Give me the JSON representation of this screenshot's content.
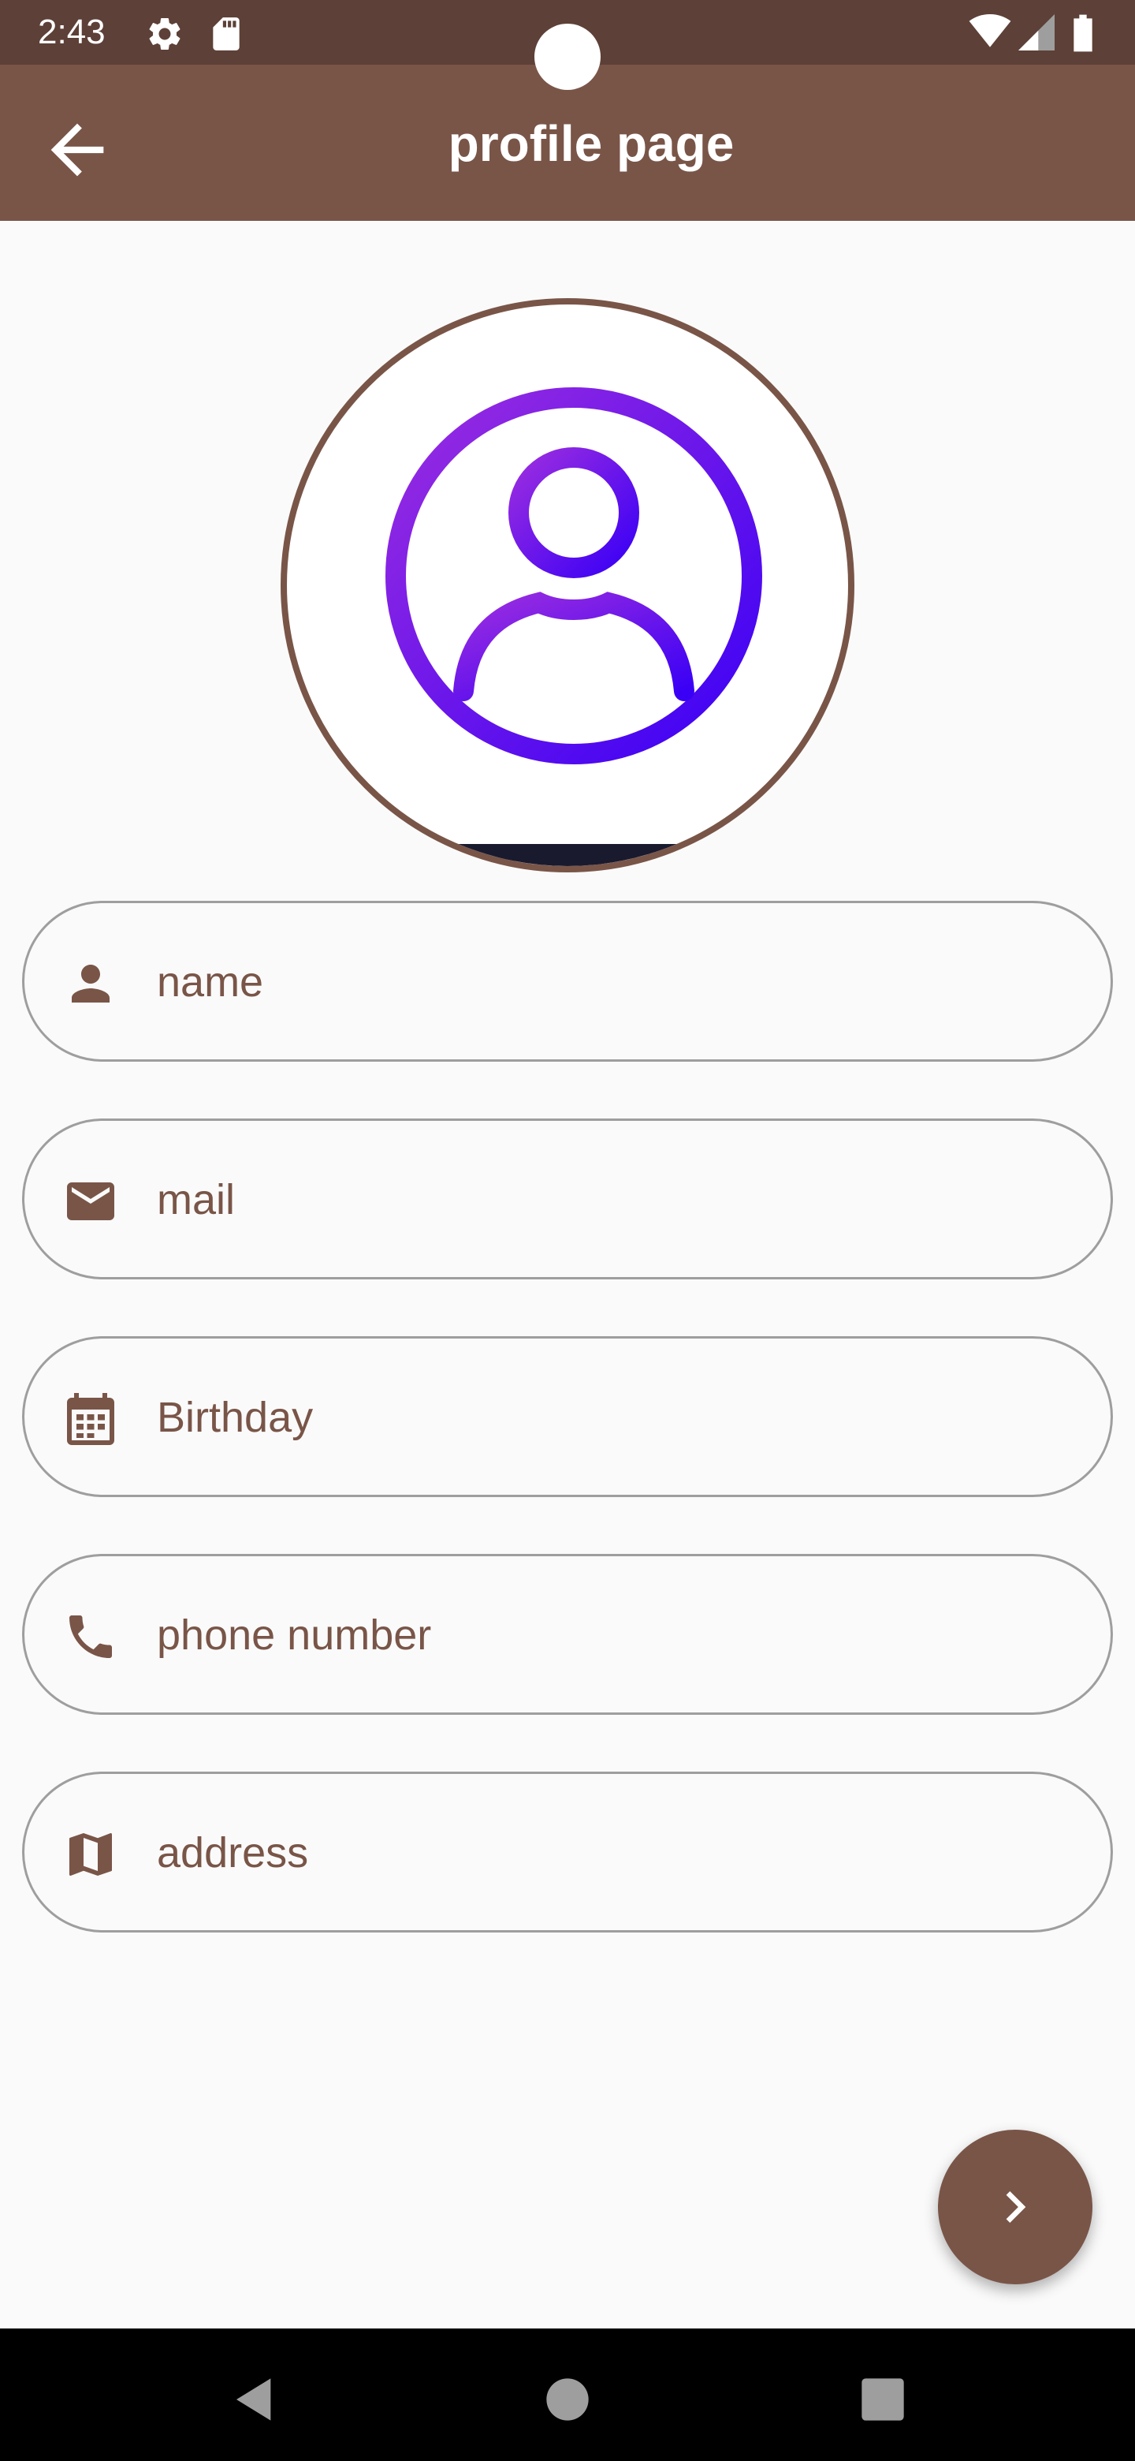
{
  "status_bar": {
    "time": "2:43",
    "icons": [
      "gear-icon",
      "sd-card-icon",
      "wifi-icon",
      "signal-icon",
      "battery-icon"
    ]
  },
  "app_bar": {
    "title": "profile page",
    "back_icon": "arrow-back-icon",
    "background": "#795548"
  },
  "avatar": {
    "icon": "user-circle-icon",
    "border_color": "#795548",
    "gradient": [
      "#8a2be2",
      "#3d00ff"
    ]
  },
  "form": {
    "fields": [
      {
        "placeholder": "name",
        "icon": "person-icon"
      },
      {
        "placeholder": "mail",
        "icon": "mail-icon"
      },
      {
        "placeholder": "Birthday",
        "icon": "calendar-icon"
      },
      {
        "placeholder": "phone number",
        "icon": "phone-icon"
      },
      {
        "placeholder": "address",
        "icon": "map-icon"
      }
    ]
  },
  "fab": {
    "icon": "chevron-right-icon",
    "color": "#795548"
  },
  "nav_bar": {
    "icons": [
      "nav-back-icon",
      "nav-home-icon",
      "nav-recents-icon"
    ]
  },
  "colors": {
    "accent": "#795548",
    "status_bar": "#5d4037",
    "background": "#fafafa"
  }
}
